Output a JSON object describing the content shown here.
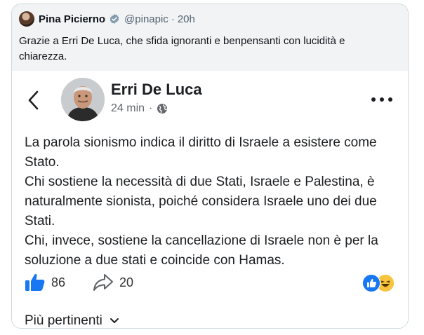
{
  "tweet": {
    "author_name": "Pina Picierno",
    "handle": "@pinapic",
    "separator": "·",
    "time": "20h",
    "text": "Grazie a Erri De Luca, che sfida ignoranti e benpensanti con lucidità e chiarezza."
  },
  "embed": {
    "author_name": "Erri De Luca",
    "time": "24 min",
    "separator": "·",
    "post_lines": [
      "La parola sionismo indica il diritto di Israele a esistere come Stato.",
      "Chi sostiene la necessità di due Stati, Israele e Palestina, è naturalmente sionista, poiché considera Israele uno dei due Stati.",
      "Chi, invece, sostiene la cancellazione di Israele non è per la soluzione a due stati e coincide con Hamas."
    ],
    "likes": "86",
    "shares": "20",
    "sort_label": "Più pertinenti"
  },
  "colors": {
    "facebook_blue": "#1877f2",
    "tweet_header_bg": "#f2f3f5",
    "verified_badge": "#829aab"
  },
  "icons": [
    "back-arrow-icon",
    "globe-icon",
    "more-options-icon",
    "like-icon",
    "share-icon",
    "chevron-down-icon",
    "verified-badge-icon"
  ]
}
